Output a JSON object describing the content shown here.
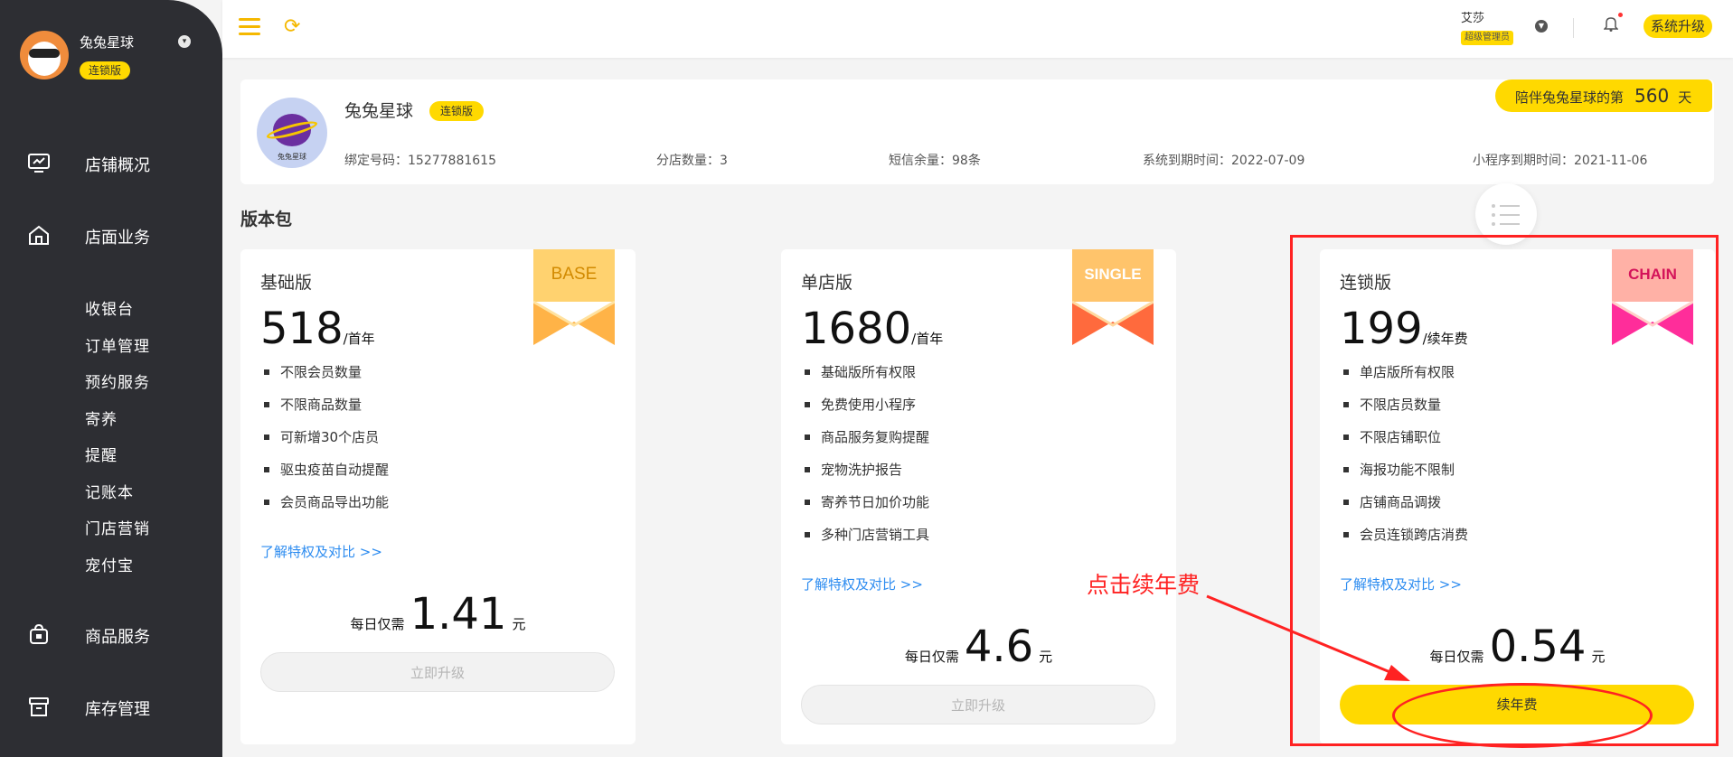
{
  "sidebar": {
    "user_name": "兔兔星球",
    "edition_badge": "连锁版",
    "menu": [
      {
        "label": "店铺概况",
        "icon": "monitor-icon"
      },
      {
        "label": "店面业务",
        "icon": "house-icon"
      },
      {
        "label": "商品服务",
        "icon": "bag-icon"
      },
      {
        "label": "库存管理",
        "icon": "inventory-icon"
      }
    ],
    "submenu": [
      "收银台",
      "订单管理",
      "预约服务",
      "寄养",
      "提醒",
      "记账本",
      "门店营销",
      "宠付宝"
    ]
  },
  "topbar": {
    "user_name": "艾莎",
    "user_role": "超级管理员",
    "upgrade_label": "系统升级",
    "icons": [
      "menu-icon",
      "refresh-icon",
      "chevron-down-icon",
      "bell-icon"
    ]
  },
  "shop": {
    "logo_text": "兔兔星球",
    "name": "兔兔星球",
    "edition_badge": "连锁版",
    "days_prefix": "陪伴兔兔星球的第",
    "days_value": "560",
    "days_suffix": "天",
    "phone": "绑定号码：15277881615",
    "branches": "分店数量：3",
    "sms": "短信余量：98条",
    "system_expire": "系统到期时间：2022-07-09",
    "miniapp_expire": "小程序到期时间：2021-11-06"
  },
  "section_title": "版本包",
  "packages": [
    {
      "name": "基础版",
      "ribbon": "BASE",
      "price": "518",
      "unit": "/首年",
      "features": [
        "不限会员数量",
        "不限商品数量",
        "可新增30个店员",
        "驱虫疫苗自动提醒",
        "会员商品导出功能"
      ],
      "link": "了解特权及对比 >>",
      "daily_prefix": "每日仅需",
      "daily_value": "1.41",
      "daily_unit": "元",
      "button": "立即升级",
      "colors": {
        "top": "#ffcf6a",
        "bottom": "#ffb347"
      }
    },
    {
      "name": "单店版",
      "ribbon": "SINGLE",
      "price": "1680",
      "unit": "/首年",
      "features": [
        "基础版所有权限",
        "免费使用小程序",
        "商品服务复购提醒",
        "宠物洗护报告",
        "寄养节日加价功能",
        "多种门店营销工具"
      ],
      "link": "了解特权及对比 >>",
      "daily_prefix": "每日仅需",
      "daily_value": "4.6",
      "daily_unit": "元",
      "button": "立即升级",
      "colors": {
        "top": "#ffc46b",
        "bottom": "#ff6a3d"
      }
    },
    {
      "name": "连锁版",
      "ribbon": "CHAIN",
      "price": "199",
      "unit": "/续年费",
      "features": [
        "单店版所有权限",
        "不限店员数量",
        "不限店铺职位",
        "海报功能不限制",
        "店铺商品调拨",
        "会员连锁跨店消费"
      ],
      "link": "了解特权及对比 >>",
      "daily_prefix": "每日仅需",
      "daily_value": "0.54",
      "daily_unit": "元",
      "button": "续年费",
      "colors": {
        "top": "#ffb3a7",
        "bottom": "#ff2d9a"
      }
    }
  ],
  "annotation": {
    "text": "点击续年费",
    "color": "#ff2222"
  }
}
